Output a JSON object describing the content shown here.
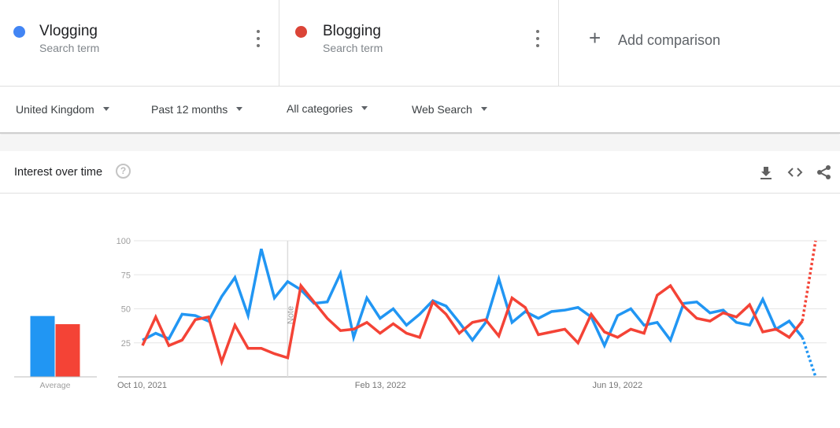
{
  "terms": [
    {
      "name": "Vlogging",
      "subtitle": "Search term",
      "color": "#4285f4",
      "more_icon": "more-vert-icon"
    },
    {
      "name": "Blogging",
      "subtitle": "Search term",
      "color": "#db4437",
      "more_icon": "more-vert-icon"
    }
  ],
  "add_comparison": {
    "icon": "+",
    "label": "Add comparison"
  },
  "filters": {
    "region": "United Kingdom",
    "time_range": "Past 12 months",
    "category": "All categories",
    "search_type": "Web Search"
  },
  "card": {
    "title": "Interest over time",
    "help_icon": "?",
    "tools": [
      "download-icon",
      "embed-icon",
      "share-icon"
    ]
  },
  "chart_data": {
    "type": "line",
    "title": "Interest over time",
    "xlabel": "",
    "ylabel": "",
    "ylim": [
      0,
      100
    ],
    "yticks": [
      25,
      50,
      75,
      100
    ],
    "grid": true,
    "x_tick_labels": [
      {
        "index": 0,
        "label": "Oct 10, 2021"
      },
      {
        "index": 18,
        "label": "Feb 13, 2022"
      },
      {
        "index": 36,
        "label": "Jun 19, 2022"
      }
    ],
    "note_marker": {
      "index": 11,
      "label": "Note"
    },
    "partial_from_index": 50,
    "series": [
      {
        "name": "Vlogging",
        "color": "#2196f3",
        "values": [
          27,
          32,
          28,
          46,
          45,
          41,
          59,
          73,
          45,
          94,
          58,
          70,
          64,
          54,
          55,
          76,
          29,
          58,
          43,
          50,
          38,
          46,
          56,
          52,
          40,
          27,
          40,
          72,
          40,
          48,
          43,
          48,
          49,
          51,
          44,
          23,
          45,
          50,
          38,
          40,
          27,
          54,
          55,
          47,
          49,
          40,
          38,
          57,
          35,
          41,
          29,
          0
        ]
      },
      {
        "name": "Blogging",
        "color": "#f44336",
        "values": [
          23,
          44,
          23,
          27,
          42,
          44,
          11,
          38,
          21,
          21,
          17,
          14,
          67,
          55,
          43,
          34,
          35,
          40,
          32,
          39,
          32,
          29,
          55,
          46,
          32,
          40,
          42,
          30,
          58,
          51,
          31,
          33,
          35,
          25,
          46,
          33,
          29,
          35,
          32,
          60,
          67,
          52,
          43,
          41,
          47,
          44,
          53,
          33,
          35,
          29,
          41,
          100
        ]
      }
    ],
    "averages": {
      "label": "Average",
      "values": [
        {
          "name": "Vlogging",
          "value": 45,
          "color": "#2196f3"
        },
        {
          "name": "Blogging",
          "value": 39,
          "color": "#f44336"
        }
      ]
    }
  }
}
